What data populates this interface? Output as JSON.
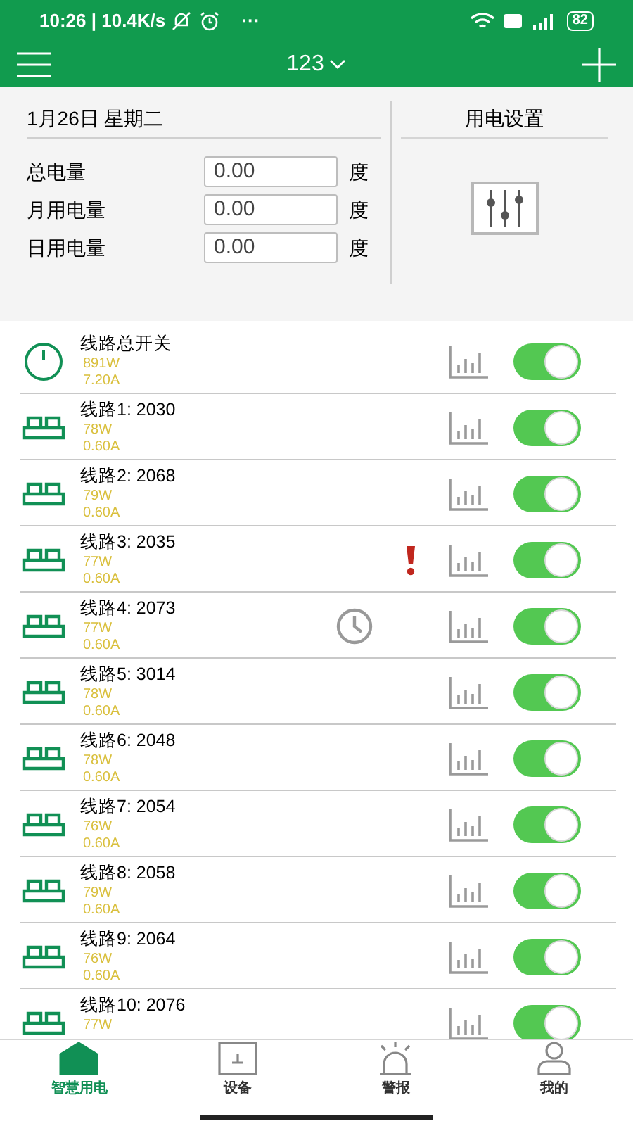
{
  "status_bar": {
    "time": "10:26 | 10.4K/s",
    "more": "···",
    "battery": "82"
  },
  "app_bar": {
    "title": "123"
  },
  "summary": {
    "date": "1月26日 星期二",
    "meters": [
      {
        "label": "总电量",
        "value": "0.00",
        "unit": "度"
      },
      {
        "label": "月用电量",
        "value": "0.00",
        "unit": "度"
      },
      {
        "label": "日用电量",
        "value": "0.00",
        "unit": "度"
      }
    ],
    "settings_title": "用电设置"
  },
  "lines": [
    {
      "kind": "master",
      "name": "线路总开关",
      "power": "891W",
      "current": "7.20A",
      "alarm": false,
      "timer": false,
      "on": true
    },
    {
      "kind": "line",
      "name": "线路1: 2030",
      "power": "78W",
      "current": "0.60A",
      "alarm": false,
      "timer": false,
      "on": true
    },
    {
      "kind": "line",
      "name": "线路2: 2068",
      "power": "79W",
      "current": "0.60A",
      "alarm": false,
      "timer": false,
      "on": true
    },
    {
      "kind": "line",
      "name": "线路3: 2035",
      "power": "77W",
      "current": "0.60A",
      "alarm": true,
      "timer": false,
      "on": true
    },
    {
      "kind": "line",
      "name": "线路4: 2073",
      "power": "77W",
      "current": "0.60A",
      "alarm": false,
      "timer": true,
      "on": true
    },
    {
      "kind": "line",
      "name": "线路5: 3014",
      "power": "78W",
      "current": "0.60A",
      "alarm": false,
      "timer": false,
      "on": true
    },
    {
      "kind": "line",
      "name": "线路6: 2048",
      "power": "78W",
      "current": "0.60A",
      "alarm": false,
      "timer": false,
      "on": true
    },
    {
      "kind": "line",
      "name": "线路7: 2054",
      "power": "76W",
      "current": "0.60A",
      "alarm": false,
      "timer": false,
      "on": true
    },
    {
      "kind": "line",
      "name": "线路8: 2058",
      "power": "79W",
      "current": "0.60A",
      "alarm": false,
      "timer": false,
      "on": true
    },
    {
      "kind": "line",
      "name": "线路9: 2064",
      "power": "76W",
      "current": "0.60A",
      "alarm": false,
      "timer": false,
      "on": true
    },
    {
      "kind": "line",
      "name": "线路10: 2076",
      "power": "77W",
      "alarm": false,
      "timer": false,
      "on": true
    }
  ],
  "nav": [
    {
      "kind": "home",
      "label": "智慧用电",
      "selected": true
    },
    {
      "kind": "device",
      "label": "设备",
      "selected": false
    },
    {
      "kind": "alarm",
      "label": "警报",
      "selected": false
    },
    {
      "kind": "user",
      "label": "我的",
      "selected": false
    }
  ]
}
